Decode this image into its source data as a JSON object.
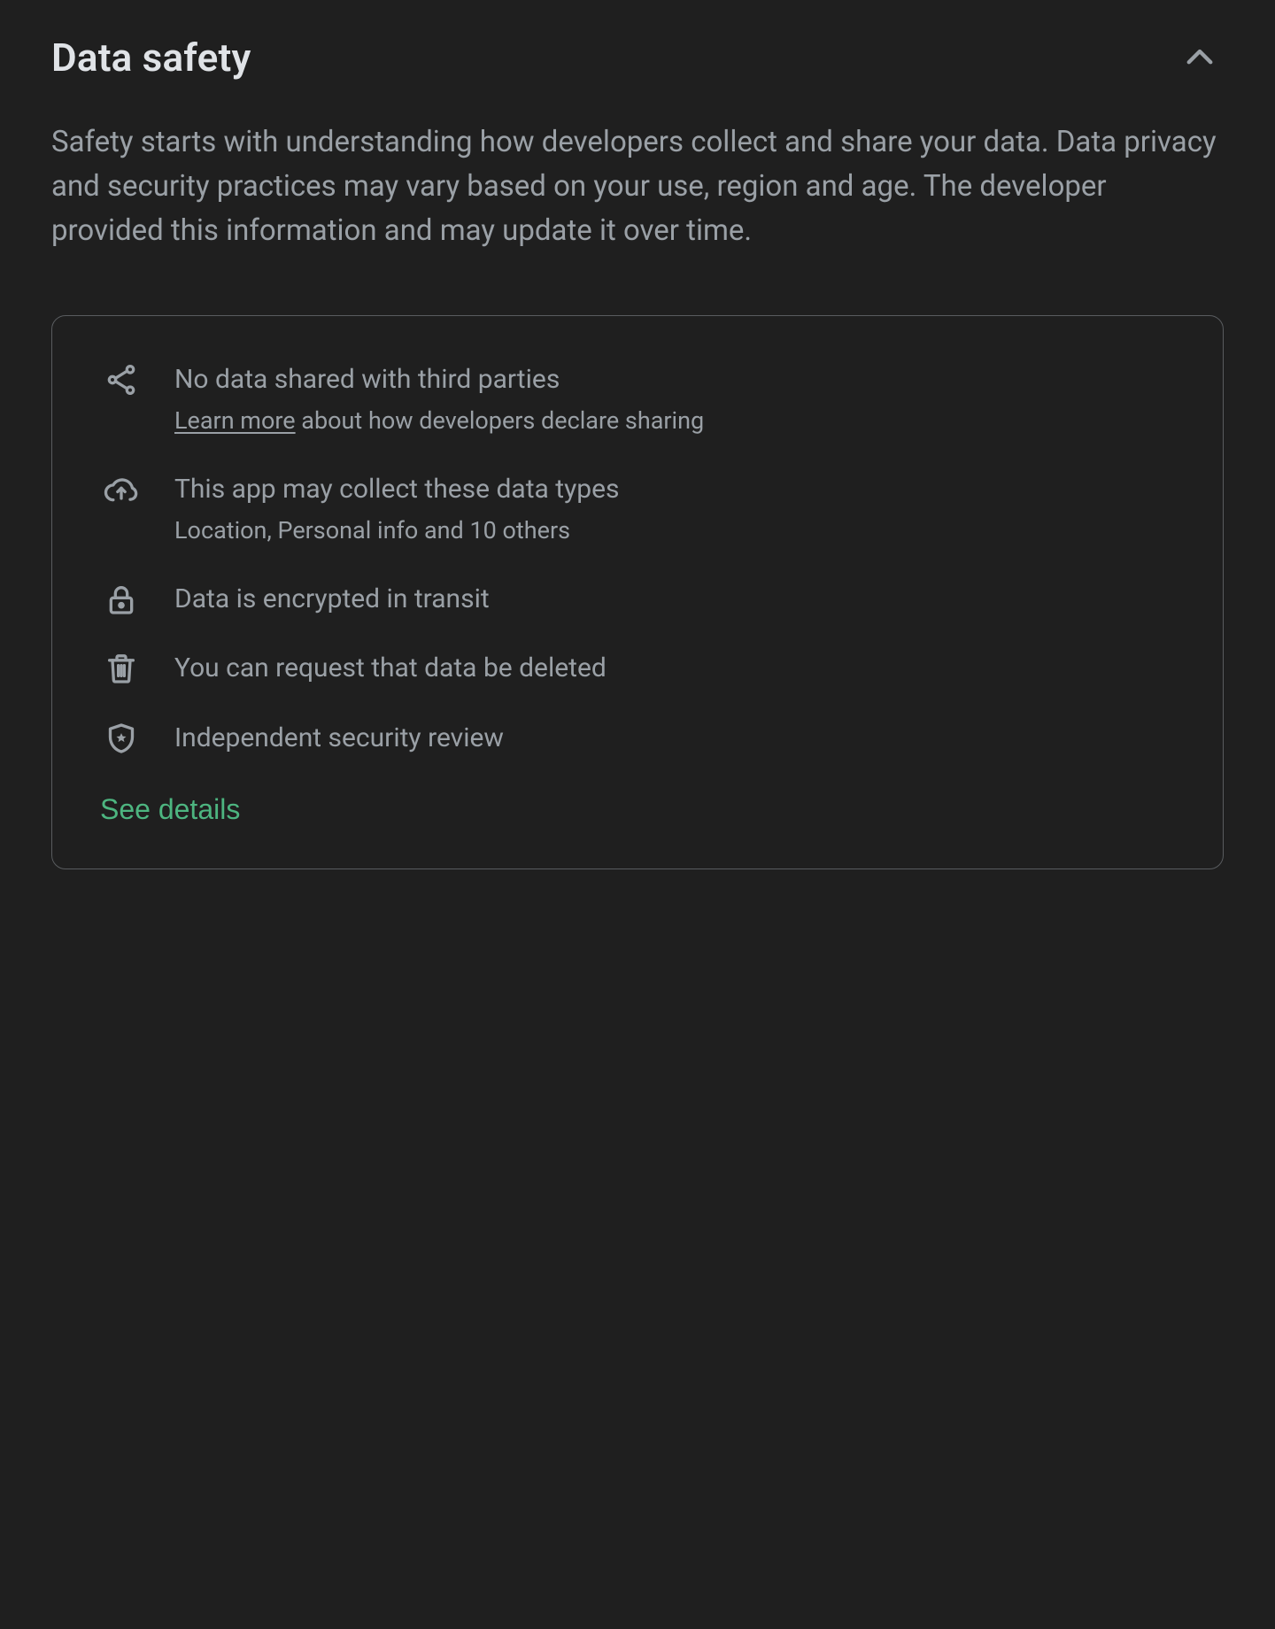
{
  "section": {
    "title": "Data safety",
    "description": "Safety starts with understanding how developers collect and share your data. Data privacy and security practices may vary based on your use, region and age. The developer provided this information and may update it over time.",
    "expanded": true
  },
  "card": {
    "items": [
      {
        "icon": "share-icon",
        "title": "No data shared with third parties",
        "learn_more_label": "Learn more",
        "sub_tail": " about how developers declare sharing"
      },
      {
        "icon": "cloud-upload-icon",
        "title": "This app may collect these data types",
        "sub": "Location, Personal info and 10 others"
      },
      {
        "icon": "lock-icon",
        "title": "Data is encrypted in transit"
      },
      {
        "icon": "trash-icon",
        "title": "You can request that data be deleted"
      },
      {
        "icon": "shield-star-icon",
        "title": "Independent security review"
      }
    ],
    "see_details_label": "See details"
  },
  "colors": {
    "accent": "#4db580"
  }
}
